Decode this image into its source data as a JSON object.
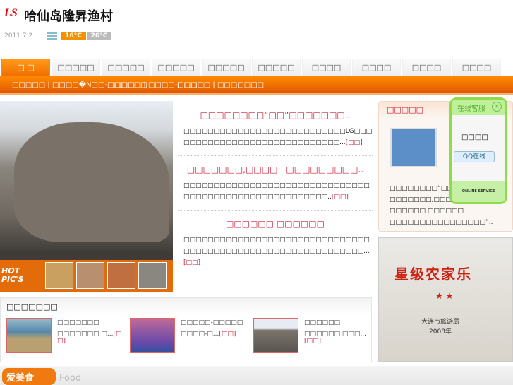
{
  "header": {
    "logo": "LS",
    "title": "哈仙岛隆昇渔村",
    "date": "2011 7 2",
    "temp_low": "16°C",
    "temp_high": "26°C"
  },
  "nav": {
    "tabs": [
      "□ □",
      "□□□□□",
      "□□□□□",
      "□□□□□",
      "□□□□□",
      "□□□□□",
      "□□□□",
      "□□□□",
      "□□□□",
      "□□□□"
    ],
    "sub_links": [
      "□□□□□ | □□□□�N□□-□□□□□□",
      "□□□□□ | □□□□-□□□□□",
      "□□□□□ | □□□□□□□"
    ]
  },
  "hero": {
    "hot_label": "HOT PIC'S"
  },
  "articles": [
    {
      "title": "□□□□□□□□“□□”□□□□□□□..",
      "body": "□□□□□□□□□□□□□□□□□□□□□□□□□□□LG□□□□□□□□□□□□□□□□□□□□□□□□□□□□□...",
      "more": "[□□]"
    },
    {
      "title": "□□□□□□□,□□□□—□□□□□□□□□..",
      "body": "□□□□□□□□□□□□□□□□□□□□□□□□□□□□□□□□□□□□□□□□□□□□□□□□□□□□□□□..",
      "more": "[□□]"
    },
    {
      "title": "□□□□□□ □□□□□□",
      "body": "□□□□□□□□□□□□□□□□□□□□□□□□□□□□□□□□□□□□□□□□□□□□□□□□□□□□□□□□□□□□□...",
      "more": "[□□]"
    }
  ],
  "right_panel": {
    "title": "□□□□□",
    "lines": [
      "□□□□□□□□“□□”□□□..",
      "□□□□□□□,□□□□—□□□□..",
      "□□□□□□ □□□□□□",
      "□□□□□□□□□□□□□□□□”.."
    ]
  },
  "qq": {
    "title": "在线客服",
    "close": "×",
    "name": "□□□□",
    "button": "QQ在线",
    "footer": "ONLINE SERVICE"
  },
  "sign": {
    "title": "星级农家乐",
    "stars": "★ ★",
    "sub": "大连市旅游局\n2008年"
  },
  "pic_box": {
    "title": "□□□□□□□",
    "items": [
      {
        "name": "□□□□□□□",
        "desc": "□□□□□□□ □...",
        "more": "[□□]"
      },
      {
        "name": "□□□□□-□□□□□",
        "desc": "□□□□-□...",
        "more": "[□□]"
      },
      {
        "name": "□□□□□□",
        "desc": "□□□□□□ □□□...",
        "more": "[□□]"
      }
    ]
  },
  "food": {
    "badge": "爱美食",
    "en": "Food"
  }
}
